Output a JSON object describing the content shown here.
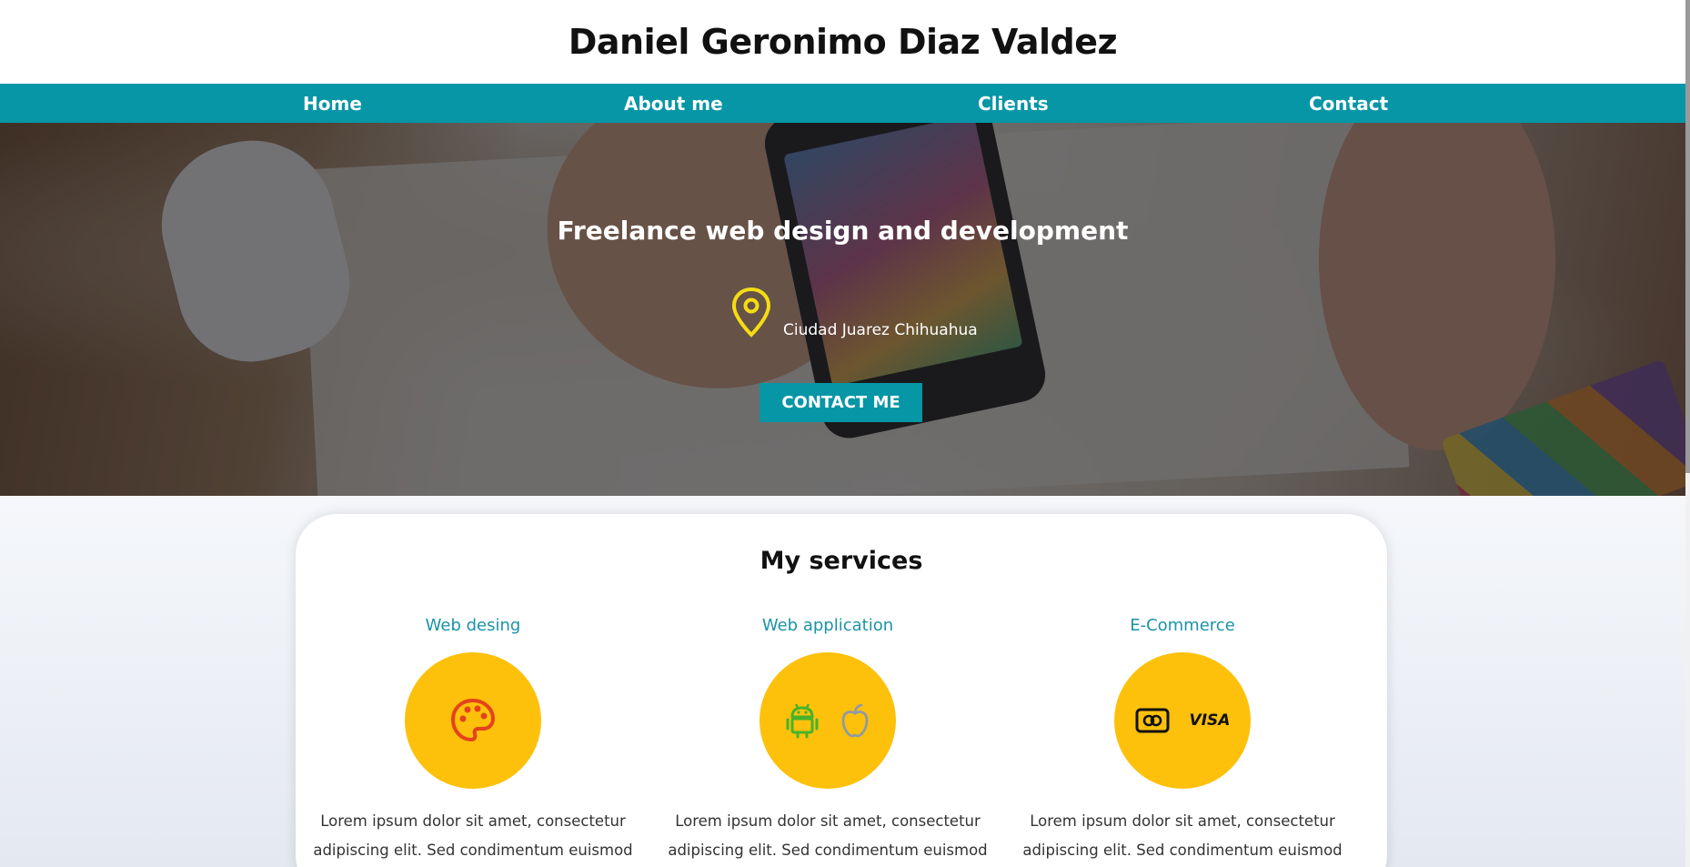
{
  "header": {
    "title": "Daniel Geronimo Diaz Valdez"
  },
  "nav": {
    "items": [
      {
        "label": "Home"
      },
      {
        "label": "About me"
      },
      {
        "label": "Clients"
      },
      {
        "label": "Contact"
      }
    ]
  },
  "hero": {
    "heading": "Freelance web design and development",
    "location": "Ciudad Juarez Chihuahua",
    "cta_label": "CONTACT ME",
    "icon": "map-pin-icon"
  },
  "services": {
    "title": "My services",
    "items": [
      {
        "title": "Web desing",
        "icons": [
          "palette-icon"
        ],
        "description": "Lorem ipsum dolor sit amet, consectetur adipiscing elit. Sed condimentum euismod"
      },
      {
        "title": "Web application",
        "icons": [
          "android-icon",
          "apple-icon"
        ],
        "description": "Lorem ipsum dolor sit amet, consectetur adipiscing elit. Sed condimentum euismod"
      },
      {
        "title": "E-Commerce",
        "icons": [
          "credit-card-icon",
          "visa-icon"
        ],
        "visa_label": "VISA",
        "description": "Lorem ipsum dolor sit amet, consectetur adipiscing elit. Sed condimentum euismod"
      }
    ]
  },
  "colors": {
    "accent": "#0796a6",
    "service_circle": "#fdc10c",
    "service_title": "#1a93a8",
    "location_icon": "#f5dc13"
  }
}
